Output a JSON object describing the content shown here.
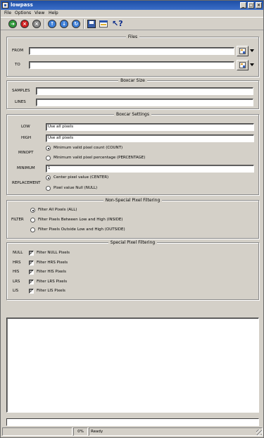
{
  "window": {
    "title": "lowpass"
  },
  "menu": [
    "File",
    "Options",
    "View",
    "Help"
  ],
  "toolbar": {
    "icons": [
      "run-icon",
      "stop-icon",
      "reset-icon",
      "up-icon",
      "down-icon",
      "reload-icon",
      "save-icon",
      "window-icon",
      "help-pointer-icon"
    ]
  },
  "files": {
    "title": "Files",
    "from_label": "FROM",
    "from_value": "",
    "to_label": "TO",
    "to_value": ""
  },
  "boxcar_size": {
    "title": "Boxcar Size",
    "samples_label": "SAMPLES",
    "samples_value": "",
    "lines_label": "LINES",
    "lines_value": ""
  },
  "boxcar_settings": {
    "title": "Boxcar Settings",
    "low_label": "LOW",
    "low_value": "Use all pixels",
    "high_label": "HIGH",
    "high_value": "Use all pixels",
    "minopt_label": "MINOPT",
    "minopt_options": [
      {
        "label": "Minimum valid pixel count (COUNT)",
        "selected": true
      },
      {
        "label": "Minimum valid pixel percentage (PERCENTAGE)",
        "selected": false
      }
    ],
    "minimum_label": "MINIMUM",
    "minimum_value": "1",
    "replacement_label": "REPLACEMENT",
    "replacement_options": [
      {
        "label": "Center pixel value (CENTER)",
        "selected": true
      },
      {
        "label": "Pixel value Null (NULL)",
        "selected": false
      }
    ]
  },
  "non_special": {
    "title": "Non-Special Pixel Filtering",
    "filter_label": "FILTER",
    "options": [
      {
        "label": "Filter All Pixels (ALL)",
        "selected": true
      },
      {
        "label": "Filter Pixels Between Low and High (INSIDE)",
        "selected": false
      },
      {
        "label": "Filter Pixels Outside Low and High (OUTSIDE)",
        "selected": false
      }
    ]
  },
  "special": {
    "title": "Special Pixel Filtering",
    "rows": [
      {
        "name": "NULL",
        "label": "Filter NULL Pixels",
        "checked": true
      },
      {
        "name": "HRS",
        "label": "Filter HRS Pixels",
        "checked": true
      },
      {
        "name": "HIS",
        "label": "Filter HIS Pixels",
        "checked": true
      },
      {
        "name": "LRS",
        "label": "Filter LRS Pixels",
        "checked": true
      },
      {
        "name": "LIS",
        "label": "Filter LIS Pixels",
        "checked": true
      }
    ]
  },
  "log": {
    "text": ""
  },
  "command_line": {
    "value": ""
  },
  "status": {
    "progress": "0%",
    "message": "Ready"
  }
}
